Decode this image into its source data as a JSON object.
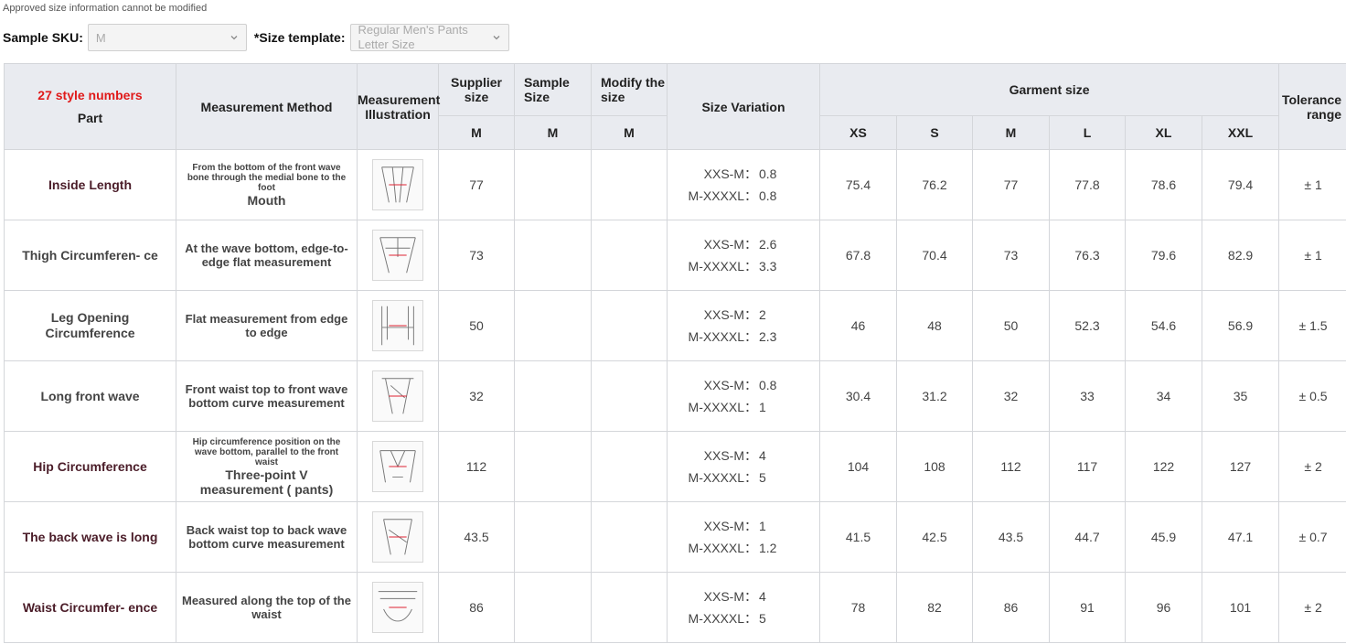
{
  "notice": "Approved size information cannot be modified",
  "controls": {
    "sku_label": "Sample SKU:",
    "sku_value": "M",
    "template_label": "*Size template:",
    "template_value_line1": "Regular Men's Pants",
    "template_value_line2": "Letter Size"
  },
  "table": {
    "headers": {
      "style_numbers": "27 style numbers",
      "part": "Part",
      "method": "Measurement Method",
      "illustration": "Measurement Illustration",
      "supplier_size": "Supplier size",
      "sample_size": "Sample Size",
      "modify_size": "Modify the size",
      "size_variation": "Size Variation",
      "garment_size": "Garment size",
      "tolerance": "Tolerance range",
      "sub_supplier": "M",
      "sub_sample": "M",
      "sub_modify": "M",
      "garment_sizes": [
        "XS",
        "S",
        "M",
        "L",
        "XL",
        "XXL"
      ]
    },
    "rows": [
      {
        "part": "Inside Length",
        "method_small": "From the bottom of the front wave bone through the medial bone to the foot",
        "method_main": "Mouth",
        "supplier": "77",
        "var_label1": "XXS-M：",
        "var_val1": "0.8",
        "var_label2": "M-XXXXL：",
        "var_val2": "0.8",
        "sizes": [
          "75.4",
          "76.2",
          "77",
          "77.8",
          "78.6",
          "79.4"
        ],
        "tolerance": "± 1"
      },
      {
        "part": "Thigh Circumferen- ce",
        "method_small": "",
        "method_main": "At the wave bottom, edge-to-edge flat measurement",
        "supplier": "73",
        "var_label1": "XXS-M：",
        "var_val1": "2.6",
        "var_label2": "M-XXXXL：",
        "var_val2": "3.3",
        "sizes": [
          "67.8",
          "70.4",
          "73",
          "76.3",
          "79.6",
          "82.9"
        ],
        "tolerance": "± 1"
      },
      {
        "part": "Leg Opening Circumference",
        "method_small": "",
        "method_main": "Flat measurement from edge to edge",
        "supplier": "50",
        "var_label1": "XXS-M：",
        "var_val1": "2",
        "var_label2": "M-XXXXL：",
        "var_val2": "2.3",
        "sizes": [
          "46",
          "48",
          "50",
          "52.3",
          "54.6",
          "56.9"
        ],
        "tolerance": "± 1.5"
      },
      {
        "part": "Long front wave",
        "method_small": "",
        "method_main": "Front waist top to front wave bottom curve measurement",
        "supplier": "32",
        "var_label1": "XXS-M：",
        "var_val1": "0.8",
        "var_label2": "M-XXXXL：",
        "var_val2": "1",
        "sizes": [
          "30.4",
          "31.2",
          "32",
          "33",
          "34",
          "35"
        ],
        "tolerance": "± 0.5"
      },
      {
        "part": "Hip Circumference",
        "method_small": "Hip circumference position on the wave bottom, parallel to the front waist",
        "method_main": "Three-point V measurement ( pants)",
        "supplier": "112",
        "var_label1": "XXS-M：",
        "var_val1": "4",
        "var_label2": "M-XXXXL：",
        "var_val2": "5",
        "sizes": [
          "104",
          "108",
          "112",
          "117",
          "122",
          "127"
        ],
        "tolerance": "± 2"
      },
      {
        "part": "The back wave is long",
        "method_small": "",
        "method_main": "Back waist top to back wave bottom curve measurement",
        "supplier": "43.5",
        "var_label1": "XXS-M：",
        "var_val1": "1",
        "var_label2": "M-XXXXL：",
        "var_val2": "1.2",
        "sizes": [
          "41.5",
          "42.5",
          "43.5",
          "44.7",
          "45.9",
          "47.1"
        ],
        "tolerance": "± 0.7"
      },
      {
        "part": "Waist Circumfer- ence",
        "method_small": "",
        "method_main": "Measured along the top of the waist",
        "supplier": "86",
        "var_label1": "XXS-M：",
        "var_val1": "4",
        "var_label2": "M-XXXXL：",
        "var_val2": "5",
        "sizes": [
          "78",
          "82",
          "86",
          "91",
          "96",
          "101"
        ],
        "tolerance": "± 2"
      }
    ]
  }
}
